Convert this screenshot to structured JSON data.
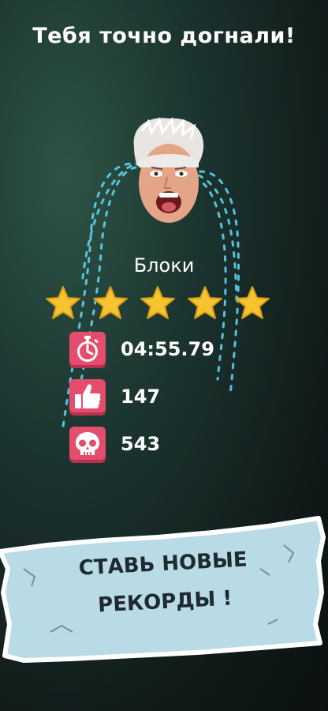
{
  "header": {
    "title": "Тебя точно догнали!"
  },
  "level": {
    "name": "Блоки",
    "stars_earned": 5,
    "stars_total": 5,
    "star_color": "#f6c331"
  },
  "stats": [
    {
      "icon": "stopwatch-icon",
      "value": "04:55.79"
    },
    {
      "icon": "thumbs-up-icon",
      "value": "147"
    },
    {
      "icon": "skull-icon",
      "value": "543"
    }
  ],
  "banner": {
    "line1": "СТАВЬ НОВЫЕ",
    "line2": "РЕКОРДЫ !"
  },
  "colors": {
    "icon_bg": "#e54d6c",
    "banner_bg": "#b9dbe6",
    "tears": "#5fd0ee"
  }
}
